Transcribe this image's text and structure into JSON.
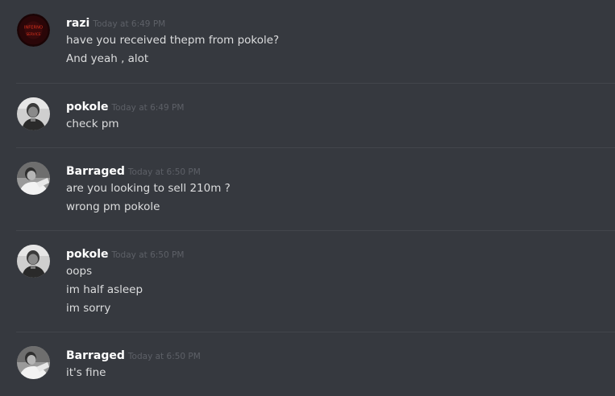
{
  "messages": [
    {
      "author": "razi",
      "timestamp": "Today at 6:49 PM",
      "avatar": "razi-logo-avatar",
      "avatar_text": [
        "INFERNO",
        "SERVICE"
      ],
      "lines": [
        "have you received thepm from pokole?",
        "And yeah , alot"
      ]
    },
    {
      "author": "pokole",
      "timestamp": "Today at 6:49 PM",
      "avatar": "pokole-photo-avatar",
      "lines": [
        "check pm"
      ]
    },
    {
      "author": "Barraged",
      "timestamp": "Today at 6:50 PM",
      "avatar": "barraged-photo-avatar",
      "lines": [
        "are you looking to sell 210m ?",
        "wrong pm pokole"
      ]
    },
    {
      "author": "pokole",
      "timestamp": "Today at 6:50 PM",
      "avatar": "pokole-photo-avatar",
      "lines": [
        "oops",
        "im half asleep",
        "im sorry"
      ]
    },
    {
      "author": "Barraged",
      "timestamp": "Today at 6:50 PM",
      "avatar": "barraged-photo-avatar",
      "lines": [
        "it's fine"
      ]
    }
  ],
  "colors": {
    "background": "#36393f",
    "username": "#ffffff",
    "timestamp": "#5d6067",
    "text": "#dcddde",
    "divider": "#42454b",
    "razi_avatar_bg": "#2a0608",
    "razi_avatar_text": "#d8301c"
  }
}
